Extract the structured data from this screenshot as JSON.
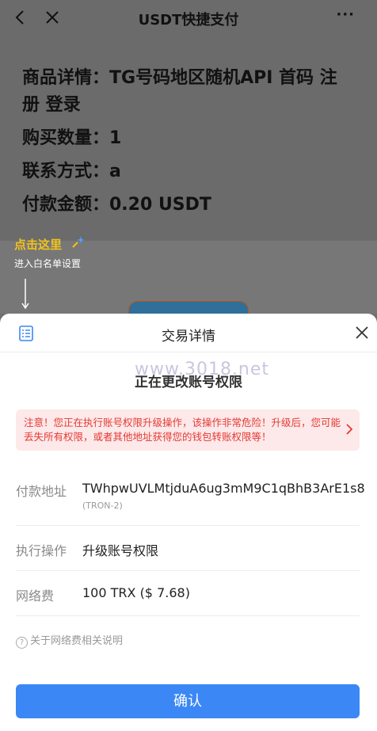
{
  "topbar": {
    "title": "USDT快捷支付",
    "more": "···"
  },
  "order": {
    "line1": "商品详情：TG号码地区随机API 首码 注册 登录",
    "line2": "购买数量：1",
    "line3": "联系方式：a",
    "line4": "付款金额：0.20 USDT"
  },
  "hint": {
    "title": "点击这里",
    "sub": "进入白名单设置"
  },
  "sheet": {
    "title": "交易详情",
    "watermark": "www.3018.net",
    "changing": "正在更改账号权限",
    "warning": "注意！您正在执行账号权限升级操作，该操作非常危险！升级后，您可能丢失所有权限，或者其他地址获得您的钱包转账权限等！",
    "rows": [
      {
        "key": "付款地址",
        "value": "TWhpwUVLMtjduA6ug3mM9C1qBhB3ArE1s8",
        "sub": "(TRON-2)"
      },
      {
        "key": "执行操作",
        "value": "升级账号权限"
      },
      {
        "key": "网络费",
        "value": "100 TRX ($ 7.68)"
      }
    ],
    "fee_note": "关于网络费相关说明",
    "confirm": "确认"
  },
  "colors": {
    "accent": "#3a87f5",
    "warning": "#e53935",
    "hint": "#f1c21b"
  }
}
